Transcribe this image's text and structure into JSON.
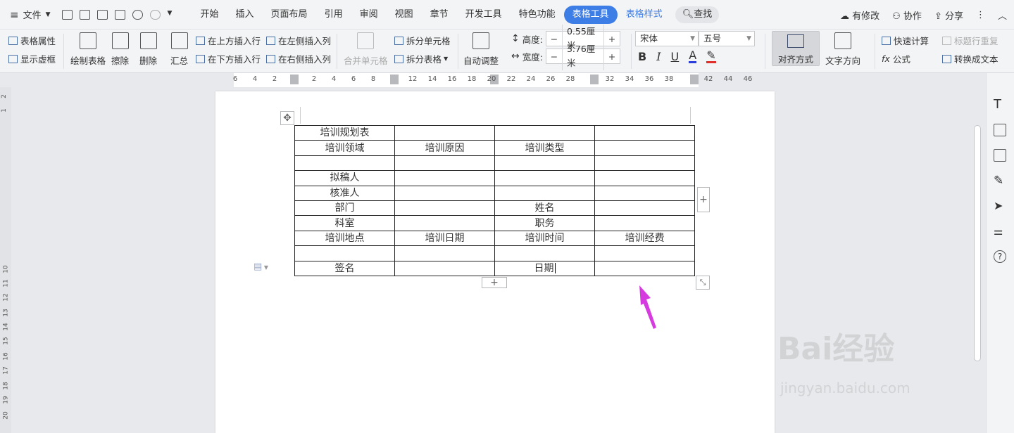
{
  "menu": {
    "file_label": "文件"
  },
  "tabs": [
    "开始",
    "插入",
    "页面布局",
    "引用",
    "审阅",
    "视图",
    "章节",
    "开发工具",
    "特色功能"
  ],
  "active_tab": "表格工具",
  "accent_tab": "表格样式",
  "search_label": "查找",
  "right_actions": {
    "modified": "有修改",
    "collab": "协作",
    "share": "分享"
  },
  "ribbon": {
    "table_props": "表格属性",
    "show_gridlines": "显示虚框",
    "draw_table": "绘制表格",
    "erase": "擦除",
    "delete": "删除",
    "summary": "汇总",
    "insert_above": "在上方插入行",
    "insert_below": "在下方插入行",
    "insert_left": "在左侧插入列",
    "insert_right": "在右侧插入列",
    "merge_cells": "合并单元格",
    "split_cells": "拆分单元格",
    "split_table": "拆分表格",
    "auto_fit": "自动调整",
    "height_label": "高度:",
    "height_value": "0.55厘米",
    "width_label": "宽度:",
    "width_value": "3.76厘米",
    "font_name": "宋体",
    "font_size": "五号",
    "align": "对齐方式",
    "text_dir": "文字方向",
    "quick_calc": "快速计算",
    "repeat_header": "标题行重复",
    "formula": "公式",
    "to_text": "转换成文本"
  },
  "ruler_labels": [
    "6",
    "4",
    "2",
    "2",
    "4",
    "6",
    "8",
    "12",
    "14",
    "16",
    "18",
    "20",
    "22",
    "24",
    "26",
    "28",
    "32",
    "34",
    "36",
    "38",
    "42",
    "44",
    "46"
  ],
  "vruler_labels": [
    "2",
    "1",
    "10",
    "11",
    "12",
    "13",
    "14",
    "15",
    "16",
    "17",
    "18",
    "19",
    "20"
  ],
  "table": [
    [
      "培训规划表",
      "",
      "",
      ""
    ],
    [
      "培训领域",
      "培训原因",
      "培训类型",
      ""
    ],
    [
      "",
      "",
      "",
      ""
    ],
    [
      "拟稿人",
      "",
      "",
      ""
    ],
    [
      "核准人",
      "",
      "",
      ""
    ],
    [
      "部门",
      "",
      "姓名",
      ""
    ],
    [
      "科室",
      "",
      "职务",
      ""
    ],
    [
      "培训地点",
      "培训日期",
      "培训时间",
      "培训经费"
    ],
    [
      "",
      "",
      "",
      ""
    ],
    [
      "签名",
      "",
      "日期",
      ""
    ]
  ],
  "watermark": {
    "brand": "Bai经验",
    "url": "jingyan.baidu.com"
  },
  "colors": {
    "accent": "#3d7de6",
    "annotation_arrow": "#d63be0"
  }
}
